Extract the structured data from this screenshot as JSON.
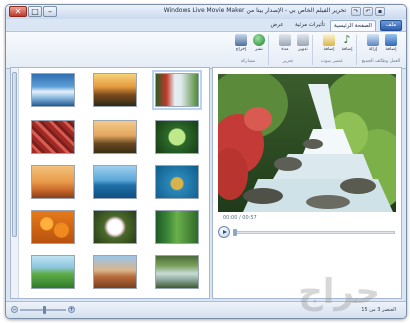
{
  "window": {
    "title": "تحرير الفيلم الخاص بي - الإصدار بيتا من Windows Live Movie Maker",
    "controls": {
      "minimize": "–",
      "maximize": "□",
      "close": "✕"
    },
    "quick_access": [
      "save",
      "undo",
      "redo"
    ]
  },
  "tabs": [
    {
      "label": "الصفحة الرئيسية",
      "active": true
    },
    {
      "label": "تأثيرات مرئية",
      "active": false
    },
    {
      "label": "عرض",
      "active": false
    }
  ],
  "file_menu_label": "ملف",
  "ribbon": {
    "buttons": [
      {
        "label": "إضافة",
        "icon": "add-video-icon"
      },
      {
        "label": "إزالة",
        "icon": "remove-icon"
      },
      {
        "label": "إضافة",
        "icon": "music-icon"
      },
      {
        "label": "إضافة",
        "icon": "text-icon"
      },
      {
        "label": "تدوير",
        "icon": "rotate-icon"
      },
      {
        "label": "مدة",
        "icon": "duration-icon"
      },
      {
        "label": "نشر",
        "icon": "publish-icon"
      },
      {
        "label": "إخراج",
        "icon": "output-icon"
      }
    ],
    "groups": [
      "العمل وظائف الجميع",
      "تصدير",
      "عنصر صوت",
      "تحرير",
      "مشاركة"
    ]
  },
  "storyboard": {
    "tiles": [
      {
        "name": "glacier",
        "selected": false
      },
      {
        "name": "autumn-sunset",
        "selected": false
      },
      {
        "name": "waterfall",
        "selected": true
      },
      {
        "name": "red-leaves",
        "selected": false
      },
      {
        "name": "tree",
        "selected": false
      },
      {
        "name": "green-leaf",
        "selected": false
      },
      {
        "name": "desert",
        "selected": false
      },
      {
        "name": "whale",
        "selected": false
      },
      {
        "name": "turtle",
        "selected": false
      },
      {
        "name": "orange-flowers",
        "selected": false
      },
      {
        "name": "white-flower",
        "selected": false
      },
      {
        "name": "forest",
        "selected": false
      },
      {
        "name": "green-hills",
        "selected": false
      },
      {
        "name": "rock",
        "selected": false
      },
      {
        "name": "river",
        "selected": false
      }
    ]
  },
  "preview": {
    "timecode": "00:00 / 00:57"
  },
  "status": {
    "text": "العنصر 3 من 15",
    "zoom_level": 0.55
  },
  "watermark": "حراج",
  "colors": {
    "accent": "#2d5fae",
    "window_bg": "#dbe6f4",
    "pane_border": "#a6b7cf"
  }
}
